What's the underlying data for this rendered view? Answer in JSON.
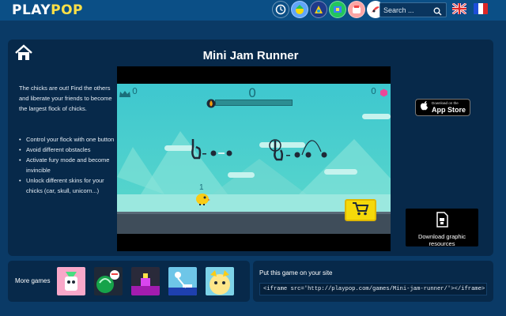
{
  "header": {
    "logo_part1": "PLAY",
    "logo_part2": "POP",
    "nav_icons": [
      "history-icon",
      "game-category-1-icon",
      "game-category-2-icon",
      "game-category-3-icon",
      "game-category-4-icon",
      "game-category-5-icon"
    ],
    "search_placeholder": "Search ...",
    "languages": [
      "English",
      "Français"
    ]
  },
  "game": {
    "title": "Mini Jam Runner",
    "description": "The chicks are out! Find the others and liberate your friends to become the largest flock of chicks.",
    "features": [
      "Control your flock with one button",
      "Avoid different obstacles",
      "Activate fury mode and become invincible",
      "Unlock different skins for your chicks (car, skull, unicorn...)"
    ],
    "hud": {
      "crowns": "0",
      "score": "0",
      "gems": "0",
      "level_label": "1"
    }
  },
  "appstore": {
    "small_label": "Download on the",
    "store_name": "App Store"
  },
  "download_resources": {
    "label": "Download graphic resources"
  },
  "more_games": {
    "label": "More games",
    "thumbnails": [
      {
        "name": "more-game-1",
        "bg": "#f9a8c9"
      },
      {
        "name": "more-game-2",
        "bg": "#1f2937"
      },
      {
        "name": "more-game-3",
        "bg": "#2a2a3a"
      },
      {
        "name": "more-game-4",
        "bg": "#6ec6e8"
      },
      {
        "name": "more-game-5",
        "bg": "#7dd3e8"
      }
    ]
  },
  "embed": {
    "label": "Put this game on your site",
    "code": "<iframe src='http://playpop.com/games/Mini-jam-runner/'></iframe>"
  },
  "colors": {
    "background": "#0a3a66",
    "header": "#0b4f86",
    "panel": "#07294a",
    "logo_accent": "#fde047",
    "sky": "#3ec7cf",
    "shop_button": "#f5d90a"
  }
}
